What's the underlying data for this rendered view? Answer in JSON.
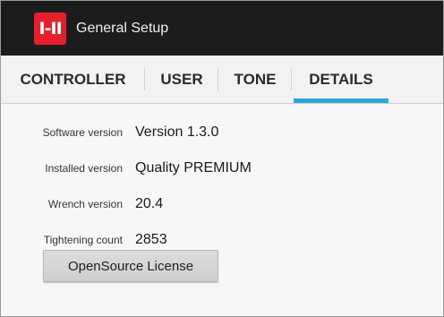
{
  "app": {
    "logo_text": "I-II",
    "title": "General Setup",
    "brand_color": "#e4202c"
  },
  "tabs": [
    {
      "label": "CONTROLLER",
      "active": false
    },
    {
      "label": "USER",
      "active": false
    },
    {
      "label": "TONE",
      "active": false
    },
    {
      "label": "DETAILS",
      "active": true
    }
  ],
  "accent_color": "#2aa6d6",
  "details": [
    {
      "label": "Software version",
      "value": "Version 1.3.0"
    },
    {
      "label": "Installed version",
      "value": "Quality PREMIUM"
    },
    {
      "label": "Wrench version",
      "value": "20.4"
    },
    {
      "label": "Tightening count",
      "value": "2853"
    }
  ],
  "license_button": {
    "label": "OpenSource License"
  }
}
